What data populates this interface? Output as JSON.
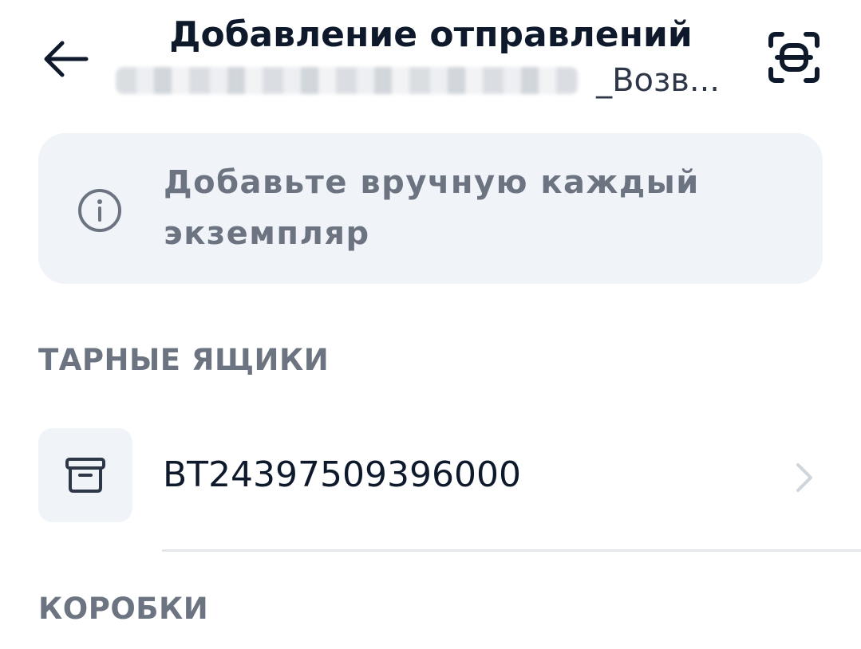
{
  "header": {
    "title": "Добавление отправлений",
    "subtitle_visible": "_Возв...",
    "back_icon": "arrow-left-icon",
    "scan_icon": "scan-frame-icon"
  },
  "info_banner": {
    "icon": "info-circle-icon",
    "text": "Добавьте вручную каждый экземпляр"
  },
  "sections": {
    "tare_boxes": {
      "title": "ТАРНЫЕ ЯЩИКИ",
      "items": [
        {
          "label": "BT24397509396000",
          "icon": "box-icon",
          "chevron": "chevron-right-icon"
        }
      ]
    },
    "boxes": {
      "title": "КОРОБКИ"
    }
  },
  "colors": {
    "title": "#0e1a2b",
    "muted_text": "#6b7480",
    "banner_bg": "#f0f3f8",
    "chevron": "#cfd5dc",
    "divider": "#e3e6ea"
  }
}
